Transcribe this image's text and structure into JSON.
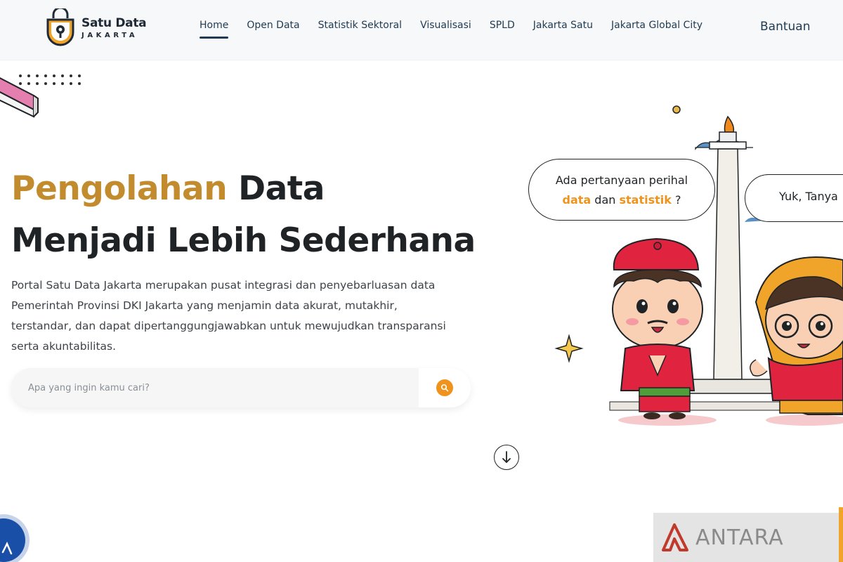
{
  "brand": {
    "title": "Satu Data",
    "subtitle": "JAKARTA"
  },
  "nav": {
    "items": [
      {
        "label": "Home",
        "active": true
      },
      {
        "label": "Open Data",
        "active": false
      },
      {
        "label": "Statistik Sektoral",
        "active": false
      },
      {
        "label": "Visualisasi",
        "active": false
      },
      {
        "label": "SPLD",
        "active": false
      },
      {
        "label": "Jakarta Satu",
        "active": false
      },
      {
        "label": "Jakarta Global City",
        "active": false
      }
    ],
    "help_label": "Bantuan"
  },
  "hero": {
    "title_accent": "Pengolahan",
    "title_rest": "Data",
    "title_line2": "Menjadi Lebih Sederhana",
    "description": "Portal Satu Data Jakarta merupakan pusat integrasi dan penyebarluasan data Pemerintah Provinsi DKI Jakarta yang menjamin data akurat, mutakhir, terstandar, dan dapat dipertanggungjawabkan untuk mewujudkan transparansi serta akuntabilitas."
  },
  "search": {
    "placeholder": "Apa yang ingin kamu cari?",
    "value": ""
  },
  "illustration": {
    "bubble1_line1": "Ada pertanyaan perihal",
    "bubble1_word1": "data",
    "bubble1_word2": "dan",
    "bubble1_word3": "statistik",
    "bubble1_end": "?",
    "bubble2": "Yuk, Tanya"
  },
  "watermark": {
    "text": "ANTARA"
  },
  "colors": {
    "accent": "#c28c2e",
    "orange": "#f0931c",
    "nav_text": "#1f3a52",
    "heading": "#1f2326",
    "chat_blue": "#1a4fa8"
  },
  "icons": [
    "logo-icon",
    "search-icon",
    "arrow-down-icon",
    "chat-icon",
    "antara-logo-icon"
  ]
}
